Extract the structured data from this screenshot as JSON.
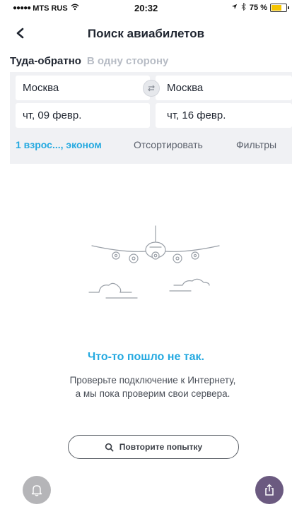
{
  "status_bar": {
    "carrier": "MTS RUS",
    "time": "20:32",
    "battery": "75 %",
    "battery_level": 0.75,
    "signal_icon": "signal-dots-icon",
    "wifi_icon": "wifi-icon",
    "location_icon": "location-arrow-icon",
    "bluetooth_icon": "bluetooth-icon"
  },
  "nav": {
    "title": "Поиск авиабилетов",
    "back_icon": "chevron-left-icon"
  },
  "trip_tabs": {
    "round_trip": "Туда-обратно",
    "one_way": "В одну сторону"
  },
  "search": {
    "from": "Москва",
    "to": "Москва",
    "depart_date": "чт, 09 февр.",
    "return_date": "чт, 16 февр.",
    "swap_icon": "swap-icon"
  },
  "options": {
    "passengers": "1 взрос..., эконом",
    "sort": "Отсортировать",
    "filters": "Фильтры"
  },
  "error": {
    "title": "Что-то пошло не так.",
    "message": "Проверьте подключение к Интернету, а мы пока проверим свои сервера.",
    "retry_label": "Повторите попытку"
  },
  "fabs": {
    "bell_icon": "bell-icon",
    "share_icon": "share-icon"
  },
  "colors": {
    "accent": "#24a9e0",
    "form_bg": "#f0f1f4",
    "share_fab": "#6b5a80",
    "bell_fab": "#b5b5b8",
    "battery": "#f5c400"
  }
}
